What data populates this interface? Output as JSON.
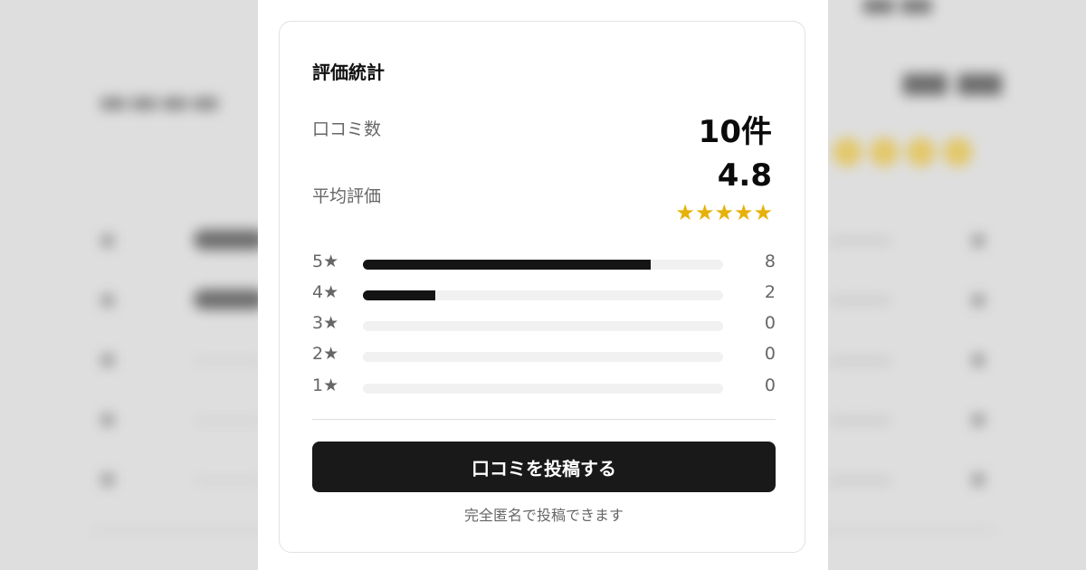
{
  "stats": {
    "title": "評価統計",
    "review_count_label": "口コミ数",
    "review_count_value": "10件",
    "average_label": "平均評価",
    "average_value": "4.8",
    "average_stars": "★★★★★",
    "average_rating": 4.8,
    "max_rating": 5
  },
  "distribution": [
    {
      "label": "5★",
      "count": "8",
      "value": 8
    },
    {
      "label": "4★",
      "count": "2",
      "value": 2
    },
    {
      "label": "3★",
      "count": "0",
      "value": 0
    },
    {
      "label": "2★",
      "count": "0",
      "value": 0
    },
    {
      "label": "1★",
      "count": "0",
      "value": 0
    }
  ],
  "distribution_total": 10,
  "actions": {
    "post_label": "口コミを投稿する",
    "anonymous_note": "完全匿名で投稿できます"
  },
  "colors": {
    "star": "#e7b10a",
    "bar_fill": "#141414",
    "bar_track": "#f1f1f1",
    "button": "#191919"
  }
}
